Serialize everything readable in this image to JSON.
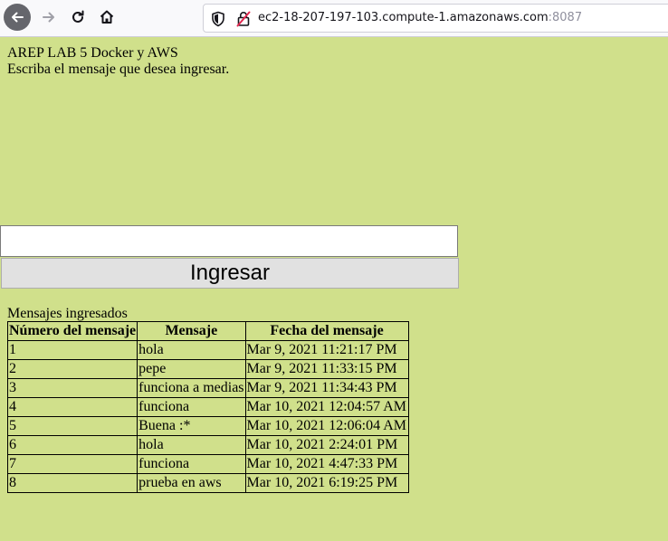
{
  "browser": {
    "url_host": "ec2-18-207-197-103.compute-1.amazonaws.com",
    "url_port": ":8087",
    "icons": [
      "back-arrow-icon",
      "forward-arrow-icon",
      "reload-icon",
      "home-icon",
      "shield-icon",
      "insecure-lock-icon"
    ]
  },
  "page": {
    "title": "AREP LAB 5 Docker y AWS",
    "instruction": "Escriba el mensaje que desea ingresar.",
    "input_value": "",
    "submit_label": "Ingresar",
    "messages_caption": "Mensajes ingresados",
    "table": {
      "headers": [
        "Número del mensaje",
        "Mensaje",
        "Fecha del mensaje"
      ],
      "rows": [
        [
          "1",
          "hola",
          "Mar 9, 2021 11:21:17 PM"
        ],
        [
          "2",
          "pepe",
          "Mar 9, 2021 11:33:15 PM"
        ],
        [
          "3",
          "funciona a medias",
          "Mar 9, 2021 11:34:43 PM"
        ],
        [
          "4",
          "funciona",
          "Mar 10, 2021 12:04:57 AM"
        ],
        [
          "5",
          "Buena :*",
          "Mar 10, 2021 12:06:04 AM"
        ],
        [
          "6",
          "hola",
          "Mar 10, 2021 2:24:01 PM"
        ],
        [
          "7",
          "funciona",
          "Mar 10, 2021 4:47:33 PM"
        ],
        [
          "8",
          "prueba en aws",
          "Mar 10, 2021 6:19:25 PM"
        ]
      ]
    }
  },
  "colors": {
    "page_background": "#d0e08b",
    "toolbar_background": "#f9f9fb",
    "button_background": "#e1e1e1"
  }
}
